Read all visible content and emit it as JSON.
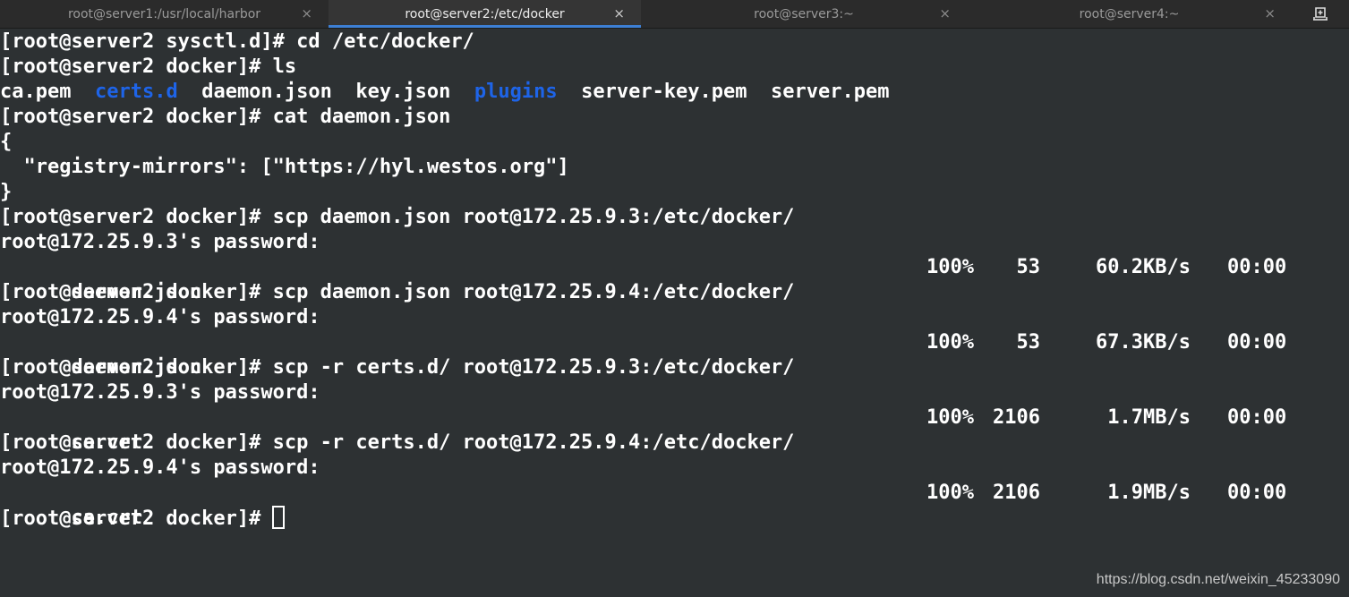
{
  "tabs": [
    {
      "label": "root@server1:/usr/local/harbor",
      "close": "×"
    },
    {
      "label": "root@server2:/etc/docker",
      "close": "×"
    },
    {
      "label": "root@server3:~",
      "close": "×"
    },
    {
      "label": "root@server4:~",
      "close": "×"
    }
  ],
  "new_tab_icon": "new-tab-icon",
  "terminal": {
    "line1": "[root@server2 sysctl.d]# cd /etc/docker/",
    "line2": "[root@server2 docker]# ls",
    "ls": {
      "f1": "ca.pem",
      "d1": "certs.d",
      "f2": "daemon.json",
      "f3": "key.json",
      "d2": "plugins",
      "f4": "server-key.pem",
      "f5": "server.pem"
    },
    "line4": "[root@server2 docker]# cat daemon.json",
    "json1": "{",
    "json2": "  \"registry-mirrors\": [\"https://hyl.westos.org\"]",
    "json3": "}",
    "scp1": {
      "cmd": "[root@server2 docker]# scp daemon.json root@172.25.9.3:/etc/docker/",
      "pw": "root@172.25.9.3's password:",
      "file": "daemon.json",
      "pct": "100%",
      "size": "53",
      "rate": "60.2KB/s",
      "eta": "00:00"
    },
    "scp2": {
      "cmd": "[root@server2 docker]# scp daemon.json root@172.25.9.4:/etc/docker/",
      "pw": "root@172.25.9.4's password:",
      "file": "daemon.json",
      "pct": "100%",
      "size": "53",
      "rate": "67.3KB/s",
      "eta": "00:00"
    },
    "scp3": {
      "cmd": "[root@server2 docker]# scp -r certs.d/ root@172.25.9.3:/etc/docker/",
      "pw": "root@172.25.9.3's password:",
      "file": "ca.crt",
      "pct": "100%",
      "size": "2106",
      "rate": "1.7MB/s",
      "eta": "00:00"
    },
    "scp4": {
      "cmd": "[root@server2 docker]# scp -r certs.d/ root@172.25.9.4:/etc/docker/",
      "pw": "root@172.25.9.4's password:",
      "file": "ca.crt",
      "pct": "100%",
      "size": "2106",
      "rate": "1.9MB/s",
      "eta": "00:00"
    },
    "prompt": "[root@server2 docker]#"
  },
  "watermark": "https://blog.csdn.net/weixin_45233090",
  "colors": {
    "background": "#2d3133",
    "text": "#ffffff",
    "directory": "#1e64e8",
    "active_tab_accent": "#3d7fd4"
  }
}
